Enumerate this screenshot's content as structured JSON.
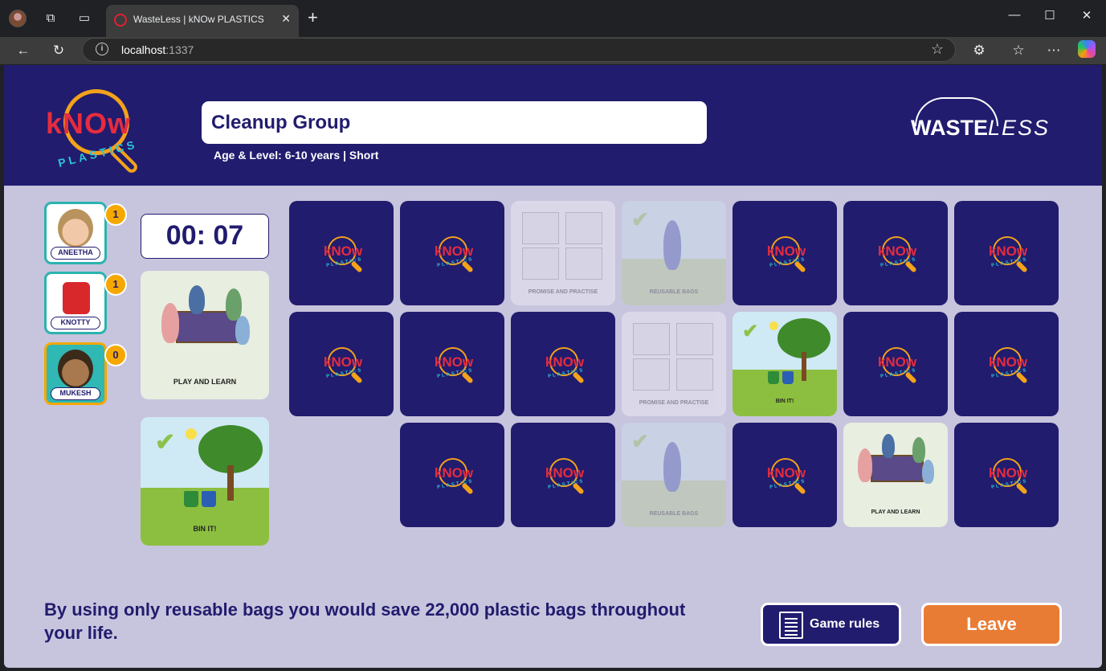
{
  "browser": {
    "tab_title": "WasteLess | kNOw PLASTICS",
    "url_host": "localhost",
    "url_port": ":1337"
  },
  "header": {
    "group_name": "Cleanup Group",
    "age_level": "Age & Level: 6-10 years | Short",
    "know_logo_text": "kNOw",
    "know_logo_sub": "PLASTICS",
    "brand_bold": "WASTE",
    "brand_light": "LESS"
  },
  "players": [
    {
      "name": "ANEETHA",
      "score": "1",
      "active": false
    },
    {
      "name": "KNOTTY",
      "score": "1",
      "active": false
    },
    {
      "name": "MUKESH",
      "score": "0",
      "active": true
    }
  ],
  "timer": "00: 07",
  "matched": [
    {
      "caption": "PLAY AND LEARN"
    },
    {
      "caption": "BIN IT!"
    }
  ],
  "cards": {
    "promise": "PROMISE AND PRACTISE",
    "reusable": "REUSABLE BAGS",
    "bin": "BIN IT!",
    "play": "PLAY AND LEARN",
    "back_logo": "kNOw",
    "back_sub": "PLASTICS"
  },
  "footer": {
    "fact": "By using only reusable bags you would save 22,000 plastic bags throughout your life.",
    "rules_label": "Game rules",
    "leave_label": "Leave"
  },
  "colors": {
    "navy": "#211c6e",
    "page_bg": "#c7c4dd",
    "orange": "#e97c34",
    "badge": "#f5a800",
    "teal": "#2ab3ae"
  }
}
